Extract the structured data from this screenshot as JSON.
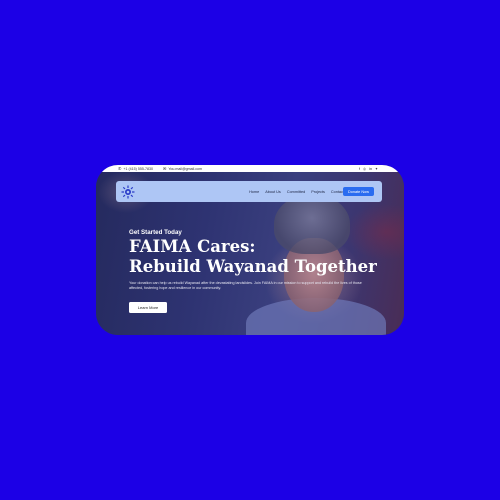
{
  "topbar": {
    "phone": "+1 (415) 555-7830",
    "email": "You.mail@gmail.com",
    "social_icons": [
      "facebook-icon",
      "instagram-icon",
      "linkedin-icon",
      "twitter-icon"
    ]
  },
  "nav": {
    "links": [
      "Home",
      "About Us",
      "Committed",
      "Projects",
      "Contact"
    ],
    "cta": "Donate Now"
  },
  "hero": {
    "eyebrow": "Get Started Today",
    "title_line1": "FAIMA Cares:",
    "title_line2": "Rebuild Wayanad Together",
    "description": "Your donation can help us rebuild Wayanad after the devastating landslides. Join FAIMA in our mission to support and rebuild the lives of those affected, fostering hope and resilience in our community.",
    "button": "Learn More"
  },
  "colors": {
    "page_background": "#1c00e6",
    "nav_background": "#aec6f5",
    "cta_background": "#2a6cf0"
  }
}
